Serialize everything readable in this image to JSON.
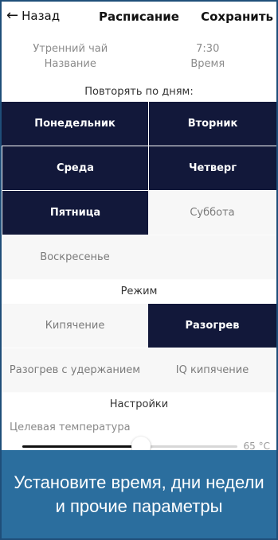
{
  "navbar": {
    "back_label": "Назад",
    "back_icon": "arrow-left",
    "title": "Расписание",
    "save_label": "Сохранить"
  },
  "schedule": {
    "name_value": "Утренний чай",
    "name_label": "Название",
    "time_value": "7:30",
    "time_label": "Время"
  },
  "repeat": {
    "heading": "Повторять по дням:",
    "days": [
      {
        "label": "Понедельник",
        "selected": true
      },
      {
        "label": "Вторник",
        "selected": true
      },
      {
        "label": "Среда",
        "selected": true
      },
      {
        "label": "Четверг",
        "selected": true
      },
      {
        "label": "Пятница",
        "selected": true
      },
      {
        "label": "Суббота",
        "selected": false
      },
      {
        "label": "Воскресенье",
        "selected": false
      }
    ]
  },
  "mode": {
    "heading": "Режим",
    "options": [
      {
        "label": "Кипячение",
        "selected": false
      },
      {
        "label": "Разогрев",
        "selected": true
      },
      {
        "label": "Разогрев с удержанием",
        "selected": false
      },
      {
        "label": "IQ кипячение",
        "selected": false
      }
    ]
  },
  "settings": {
    "heading": "Настройки",
    "target_temp_label": "Целевая температура",
    "target_temp_value": "65 °C",
    "slider_fraction": 0.55
  },
  "banner": {
    "text": "Установите время, дни недели и прочие параметры"
  },
  "colors": {
    "selected_bg": "#12183a",
    "unselected_bg": "#f7f7f7",
    "banner_bg": "#2b6e9e"
  }
}
